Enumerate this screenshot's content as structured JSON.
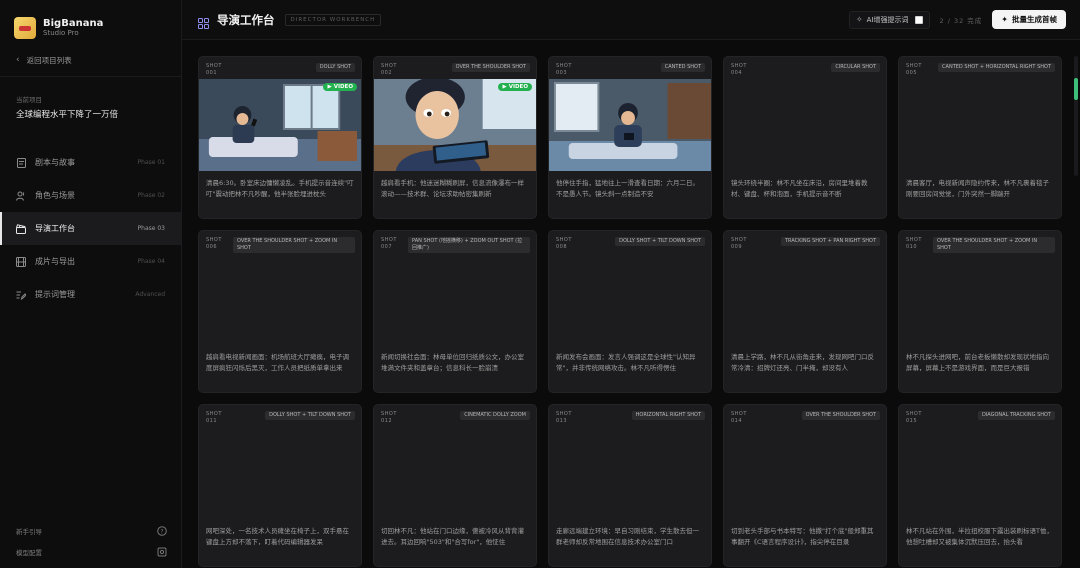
{
  "brand": {
    "name": "BigBanana",
    "sub": "Studio Pro"
  },
  "sidebar": {
    "back_label": "返回项目列表",
    "project_label": "当前项目",
    "project_title": "全球编程水平下降了一万倍",
    "nav": [
      {
        "label": "剧本与故事",
        "phase": "Phase 01",
        "icon": "document-icon"
      },
      {
        "label": "角色与场景",
        "phase": "Phase 02",
        "icon": "user-icon"
      },
      {
        "label": "导演工作台",
        "phase": "Phase 03",
        "icon": "clapperboard-icon",
        "active": true
      },
      {
        "label": "成片与导出",
        "phase": "Phase 04",
        "icon": "film-icon"
      },
      {
        "label": "提示词管理",
        "phase": "Advanced",
        "icon": "list-edit-icon"
      }
    ],
    "bottom": [
      {
        "label": "新手引导",
        "icon": "help-icon"
      },
      {
        "label": "模型配置",
        "icon": "settings-icon"
      }
    ]
  },
  "header": {
    "title": "导演工作台",
    "tag": "DIRECTOR WORKBENCH",
    "ai_label": "AI增强提示词",
    "progress": "2 / 32 完成",
    "batch_label": "批量生成首帧"
  },
  "shots": [
    {
      "id": "SHOT 001",
      "camera": "DOLLY SHOT",
      "thumb": "scene-bedroom-phone",
      "video": true,
      "desc": "清晨6:30。卧室床边慵懒凌乱。手机提示音连续\"叮叮\"震动把林不凡吵醒，他半张脸埋进枕头"
    },
    {
      "id": "SHOT 002",
      "camera": "OVER THE SHOULDER SHOT",
      "thumb": "scene-closeup-tablet",
      "video": true,
      "desc": "越肩看手机：他迷迷糊糊刷屏，信息流像瀑布一样滚动——技术群、论坛求助帖密集刷新"
    },
    {
      "id": "SHOT 003",
      "camera": "CANTED SHOT",
      "thumb": "scene-bed-phone",
      "video": false,
      "desc": "他停住手指，猛地往上一滑查看日期：六月二日。不是愚人节。镜头斜一点制造不安"
    },
    {
      "id": "SHOT 004",
      "camera": "CIRCULAR SHOT",
      "thumb": "",
      "video": false,
      "desc": "镜头环绕半圈：林不凡坐在床沿，房间里堆着教材、键盘、杯和泡面，手机提示音不断"
    },
    {
      "id": "SHOT 005",
      "camera": "CANTED SHOT + HORIZONTAL RIGHT SHOT",
      "thumb": "",
      "video": false,
      "desc": "清晨客厅，电视新闻声隐约传来，林不凡裹着毯子刚要回房间觉觉，门外突然一脚踹开"
    },
    {
      "id": "SHOT 006",
      "camera": "OVER THE SHOULDER SHOT + ZOOM IN SHOT",
      "thumb": "",
      "video": false,
      "desc": "越肩看电视新闻画面：机场航班大厅瘫痪，电子调度屏疯狂闪烁后黑灭，工作人员把纸质单拿出来"
    },
    {
      "id": "SHOT 007",
      "camera": "PAN SHOT (地摇横移) + ZOOM OUT SHOT (拉回推广)",
      "thumb": "",
      "video": false,
      "desc": "新闻切换社会面：林母单位回归纸质公文，办公室堆满文件夹和盖章台；信息科长一脸崩溃"
    },
    {
      "id": "SHOT 008",
      "camera": "DOLLY SHOT + TILT DOWN SHOT",
      "thumb": "",
      "video": false,
      "desc": "新闻发布会画面：发言人强调这是全球性\"认知异常\"，并非传统网络攻击。林不凡听得愣住"
    },
    {
      "id": "SHOT 009",
      "camera": "TRACKING SHOT + PAN RIGHT SHOT",
      "thumb": "",
      "video": false,
      "desc": "清晨上学路，林不凡从街角走来，发现网吧门口反常冷清：招牌灯还亮、门半掩，却没有人"
    },
    {
      "id": "SHOT 010",
      "camera": "OVER THE SHOULDER SHOT + ZOOM IN SHOT",
      "thumb": "",
      "video": false,
      "desc": "林不凡探头进网吧，前台老板懒散却发现状地指向屏幕，屏幕上不是游戏界面，而是巨大报错"
    },
    {
      "id": "SHOT 011",
      "camera": "DOLLY SHOT + TILT DOWN SHOT",
      "thumb": "",
      "video": false,
      "desc": "网吧深处，一名技术人员瘫坐在椅子上，双手悬在键盘上方却不落下，盯着代码编辑器发呆"
    },
    {
      "id": "SHOT 012",
      "camera": "CINEMATIC DOLLY ZOOM",
      "thumb": "",
      "video": false,
      "desc": "切回林不凡：他站在门口边缘，傻被冷风从背背灌进去。耳边回响\"503\"和\"合写for\"，他怔住"
    },
    {
      "id": "SHOT 013",
      "camera": "HORIZONTAL RIGHT SHOT",
      "thumb": "",
      "video": false,
      "desc": "走廊远端建立环境：早自习刚结束，学生散去但一群老师却反常地围在信息技术办公室门口"
    },
    {
      "id": "SHOT 014",
      "camera": "OVER THE SHOULDER SHOT",
      "thumb": "",
      "video": false,
      "desc": "切到老头手部与书本特写：他撒\"打个底\"般郑重其事翻开《C语言程序设计》，指尖停在目录"
    },
    {
      "id": "SHOT 015",
      "camera": "DIAGONAL TRACKING SHOT",
      "thumb": "",
      "video": false,
      "desc": "林不凡站在外围，半拉扭校服下露出装刷标语T恤，他想吐槽却又被集体沉默压回去，抬头看"
    }
  ]
}
